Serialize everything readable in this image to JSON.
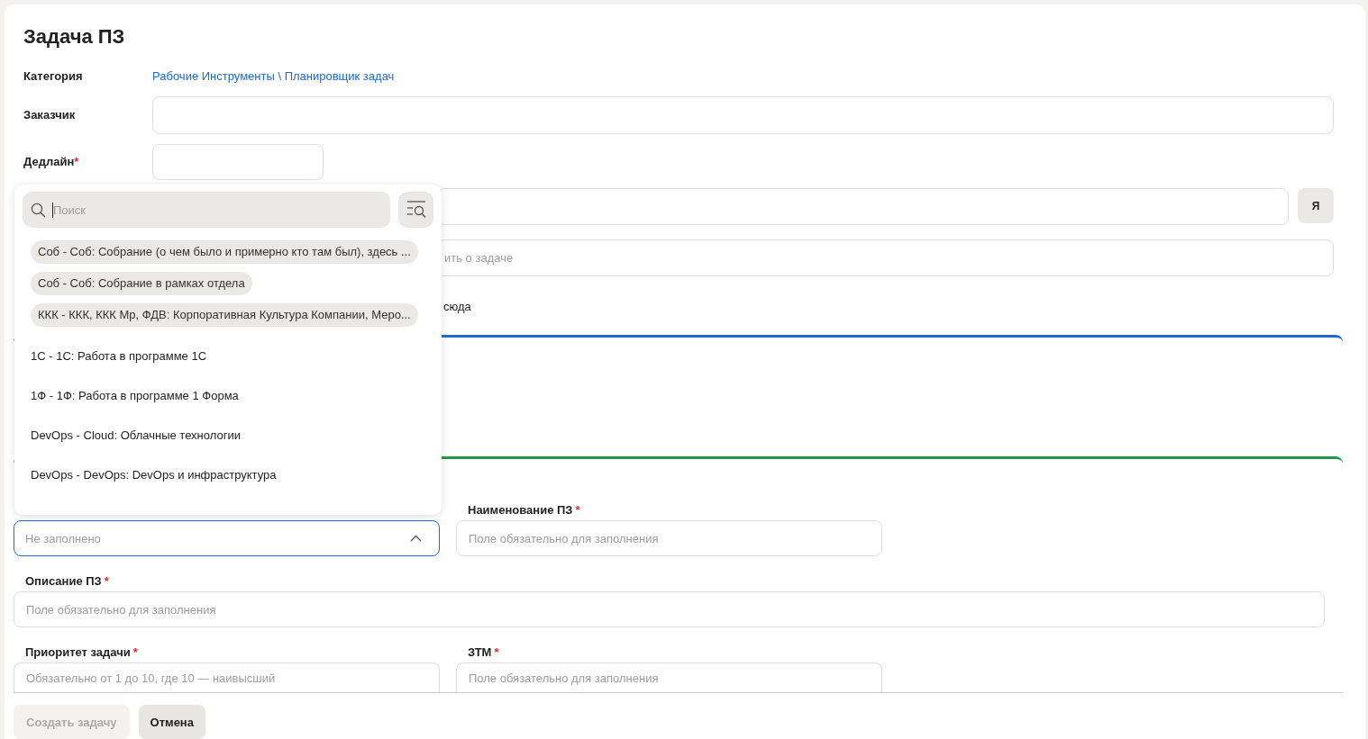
{
  "title": "Задача ПЗ",
  "header_fields": [
    {
      "kind": "link",
      "label": "Категория",
      "value": "Рабочие Инструменты \\ Планировщик задач"
    },
    {
      "kind": "text",
      "label": "Заказчик"
    },
    {
      "kind": "date",
      "label": "Дедлайн",
      "required_mark": "*"
    }
  ],
  "covered_fields": [
    {
      "kind": "input_with_button",
      "button": "Я"
    },
    {
      "kind": "input",
      "placeholder": "ить о задаче"
    },
    {
      "kind": "note",
      "text": "сюда"
    }
  ],
  "form": {
    "rows": [
      {
        "fields": [
          {
            "kind": "select",
            "placeholder": "Не заполнено",
            "open": true
          },
          {
            "kind": "input",
            "label": "Наименование ПЗ",
            "required_mark": "*",
            "placeholder": "Поле обязательно для заполнения"
          }
        ]
      },
      {
        "fields": [
          {
            "kind": "input",
            "label": "Описание ПЗ",
            "required_mark": "*",
            "placeholder": "Поле обязательно для заполнения"
          }
        ]
      },
      {
        "fields": [
          {
            "kind": "input",
            "label": "Приоритет задачи",
            "required_mark": "*",
            "placeholder": "Обязательно от 1 до 10, где 10 — наивысший"
          },
          {
            "kind": "input",
            "label": "ЗТМ",
            "required_mark": "*",
            "placeholder": "Поле обязательно для заполнения"
          }
        ]
      }
    ]
  },
  "dropdown": {
    "search": {
      "placeholder": "Поиск",
      "focused": true
    },
    "items": [
      {
        "label": "Соб - Соб: Собрание (о чем было и примерно кто там был), здесь ...",
        "selected": true
      },
      {
        "label": "Соб - Соб: Собрание в рамках отдела",
        "selected": true
      },
      {
        "label": "ККК - ККК, ККК Мр, ФДВ: Корпоративная Культура Компании, Меро...",
        "selected": true
      },
      {
        "label": "1С - 1С: Работа в программе 1С",
        "selected": false
      },
      {
        "label": "1Ф - 1Ф: Работа в программе 1 Форма",
        "selected": false
      },
      {
        "label": "DevOps - Cloud: Облачные технологии",
        "selected": false
      },
      {
        "label": "DevOps - DevOps: DevOps и инфраструктура",
        "selected": false
      }
    ]
  },
  "buttons": [
    {
      "label": "Создать задачу",
      "disabled": true
    },
    {
      "label": "Отмена",
      "disabled": false
    }
  ]
}
